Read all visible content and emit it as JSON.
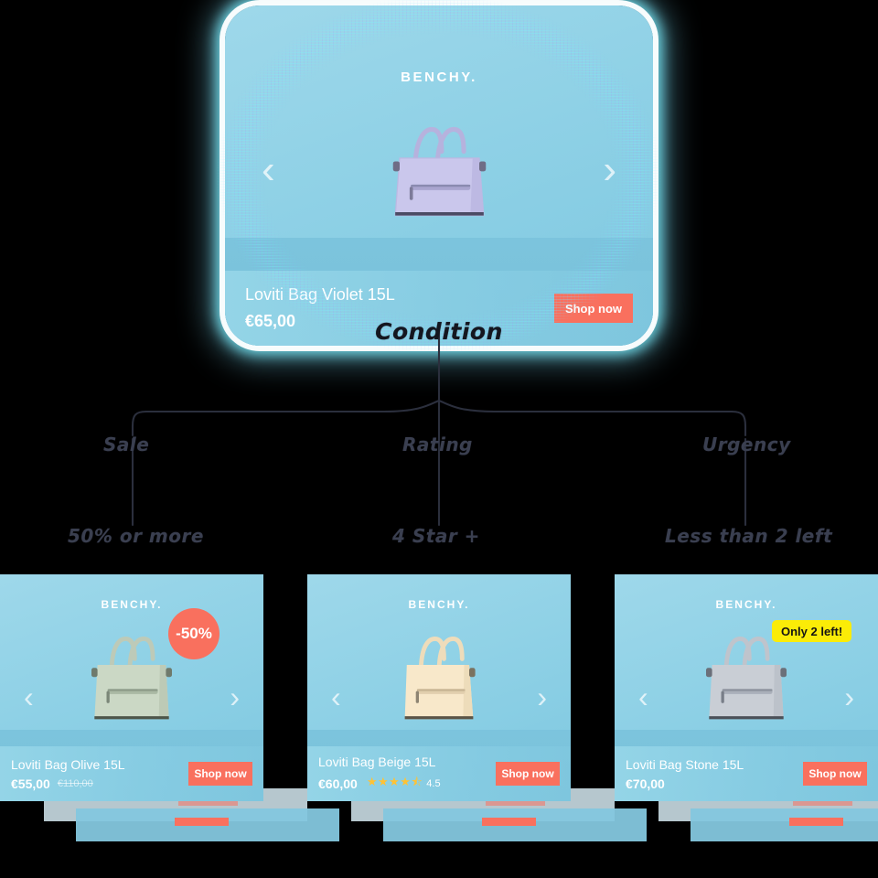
{
  "hero": {
    "brand": "BENCHY.",
    "product_name": "Loviti Bag Violet 15L",
    "price": "€65,00",
    "cta": "Shop now",
    "prev_icon": "chevron-left-icon",
    "next_icon": "chevron-right-icon",
    "bag_color": "#c9c6ea",
    "bg_color": "#8fd1e6"
  },
  "tree": {
    "root_label": "Condition",
    "branches": [
      {
        "node": "Sale",
        "leaf": "50% or more"
      },
      {
        "node": "Rating",
        "leaf": "4 Star +"
      },
      {
        "node": "Urgency",
        "leaf": "Less than 2 left"
      }
    ]
  },
  "cards": [
    {
      "brand": "BENCHY.",
      "product_name": "Loviti Bag Olive 15L",
      "price": "€55,00",
      "old_price": "€110,00",
      "cta": "Shop now",
      "badge_sale": "-50%",
      "badge_urgency": "",
      "rating_stars": "",
      "rating_value": "",
      "bag_color": "#c9d6c4"
    },
    {
      "brand": "BENCHY.",
      "product_name": "Loviti Bag Beige 15L",
      "price": "€60,00",
      "old_price": "",
      "cta": "Shop now",
      "badge_sale": "",
      "badge_urgency": "",
      "rating_stars": "★★★★⯪",
      "rating_value": "4.5",
      "bag_color": "#f7e6c8"
    },
    {
      "brand": "BENCHY.",
      "product_name": "Loviti Bag Stone 15L",
      "price": "€70,00",
      "old_price": "",
      "cta": "Shop now",
      "badge_sale": "",
      "badge_urgency": "Only 2 left!",
      "rating_stars": "",
      "rating_value": "",
      "bag_color": "#c8ccd3"
    }
  ],
  "colors": {
    "accent": "#F9705E",
    "highlight": "#FBEC07",
    "card_bg": "#8fd1e6",
    "star": "#FFC234",
    "line": "#2b2f3d",
    "background": "#000000"
  }
}
